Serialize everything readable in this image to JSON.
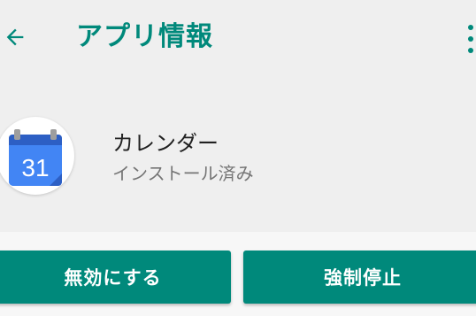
{
  "header": {
    "title": "アプリ情報",
    "back_icon": "arrow-back-icon",
    "menu_icon": "more-vert-icon"
  },
  "app": {
    "name": "カレンダー",
    "status": "インストール済み",
    "icon": "calendar-icon",
    "icon_day": "31"
  },
  "actions": {
    "disable_label": "無効にする",
    "force_stop_label": "強制停止"
  },
  "colors": {
    "accent": "#00897b",
    "background": "#efefef",
    "calendar_blue": "#4285f4"
  }
}
